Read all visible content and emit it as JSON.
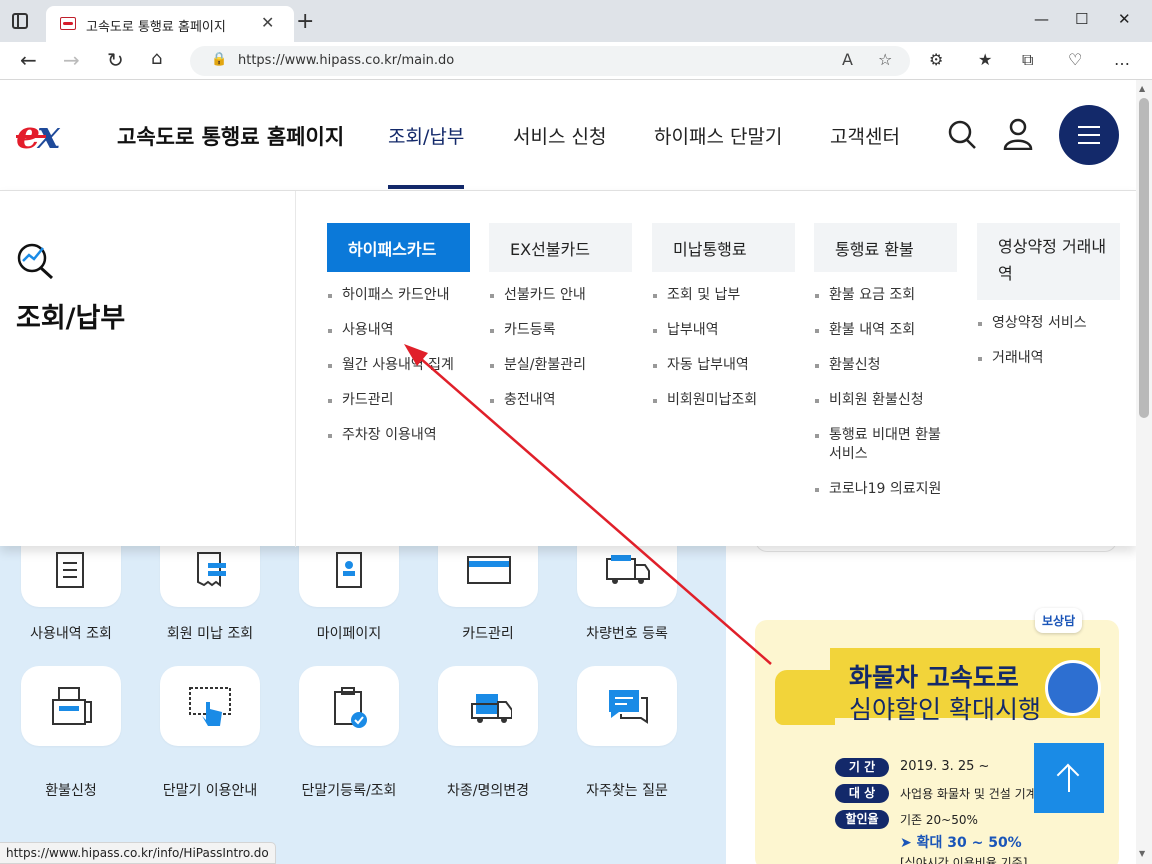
{
  "browser": {
    "tab_title": "고속도로 통행료 홈페이지",
    "url": "https://www.hipass.co.kr/main.do",
    "status_url": "https://www.hipass.co.kr/info/HiPassIntro.do"
  },
  "header": {
    "logo_mark_e": "e",
    "logo_mark_x": "x",
    "site_title": "고속도로 통행료 홈페이지",
    "gnb": [
      "조회/납부",
      "서비스 신청",
      "하이패스 단말기",
      "고객센터"
    ]
  },
  "mega_menu": {
    "section_title": "조회/납부",
    "columns": [
      {
        "title": "하이패스카드",
        "items": [
          "하이패스 카드안내",
          "사용내역",
          "월간 사용내역 집계",
          "카드관리",
          "주차장 이용내역"
        ]
      },
      {
        "title": "EX선불카드",
        "items": [
          "선불카드 안내",
          "카드등록",
          "분실/환불관리",
          "충전내역"
        ]
      },
      {
        "title": "미납통행료",
        "items": [
          "조회 및 납부",
          "납부내역",
          "자동 납부내역",
          "비회원미납조회"
        ]
      },
      {
        "title": "통행료 환불",
        "items": [
          "환불 요금 조회",
          "환불 내역 조회",
          "환불신청",
          "비회원 환불신청",
          "통행료 비대면 환불 서비스",
          "코로나19 의료지원"
        ]
      },
      {
        "title": "영상약정 거래내역",
        "items": [
          "영상약정 서비스",
          "거래내역"
        ]
      }
    ]
  },
  "quick_services": [
    "사용내역 조회",
    "회원 미납 조회",
    "마이페이지",
    "카드관리",
    "차량번호 등록",
    "환불신청",
    "단말기 이용안내",
    "단말기등록/조회",
    "차종/명의변경",
    "자주찾는 질문"
  ],
  "banner": {
    "bubble": "보상담",
    "title1": "화물차 고속도로",
    "title2": "심야할인 확대시행",
    "rows": [
      {
        "label": "기 간",
        "text": "2019. 3. 25 ~"
      },
      {
        "label": "대 상",
        "text": "사업용 화물차 및 건설 기계"
      },
      {
        "label": "할인율",
        "text": "기존 20~50%"
      }
    ],
    "accent": "➤ 확대 30 ~ 50%",
    "footnote": "[심야시간 이용비율 기준]"
  },
  "colors": {
    "brand_navy": "#13296a",
    "active_blue": "#0b79d9",
    "logo_red": "#e31d2b",
    "annotation_arrow": "#e0202a"
  },
  "icons": [
    "search-icon",
    "user-icon",
    "hamburger-icon",
    "magnifier-chart-icon",
    "arrow-up-icon"
  ]
}
